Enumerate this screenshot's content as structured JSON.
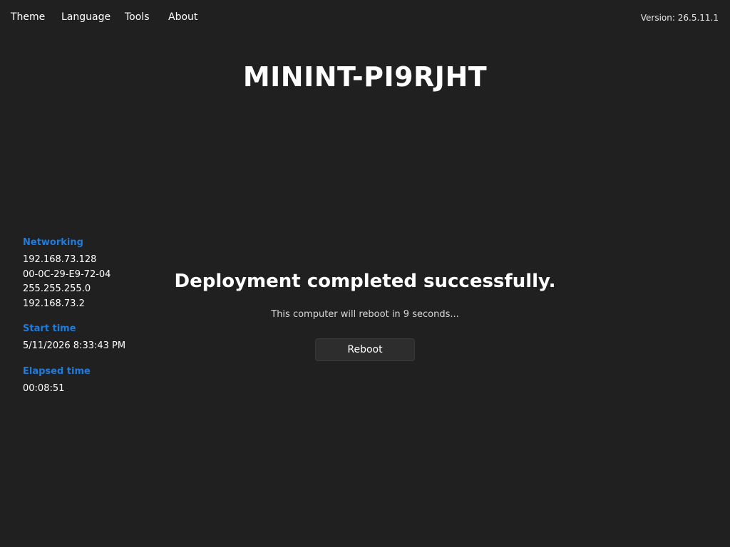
{
  "menu": {
    "theme": "Theme",
    "language": "Language",
    "tools": "Tools",
    "about": "About"
  },
  "version": "Version: 26.5.11.1",
  "computer_name": "MININT-PI9RJHT",
  "networking": {
    "heading": "Networking",
    "ip_address": "192.168.73.128",
    "mac_address": "00-0C-29-E9-72-04",
    "subnet_mask": "255.255.255.0",
    "gateway": "192.168.73.2"
  },
  "start_time": {
    "heading": "Start time",
    "value": "5/11/2026 8:33:43 PM"
  },
  "elapsed_time": {
    "heading": "Elapsed time",
    "value": "00:08:51"
  },
  "status": {
    "title": "Deployment completed successfully.",
    "message": "This computer will reboot in 9 seconds..."
  },
  "reboot_button": {
    "label": "Reboot"
  },
  "colors": {
    "background": "#202020",
    "accent": "#1f7bdc",
    "button_bg": "#2d2d2d"
  }
}
